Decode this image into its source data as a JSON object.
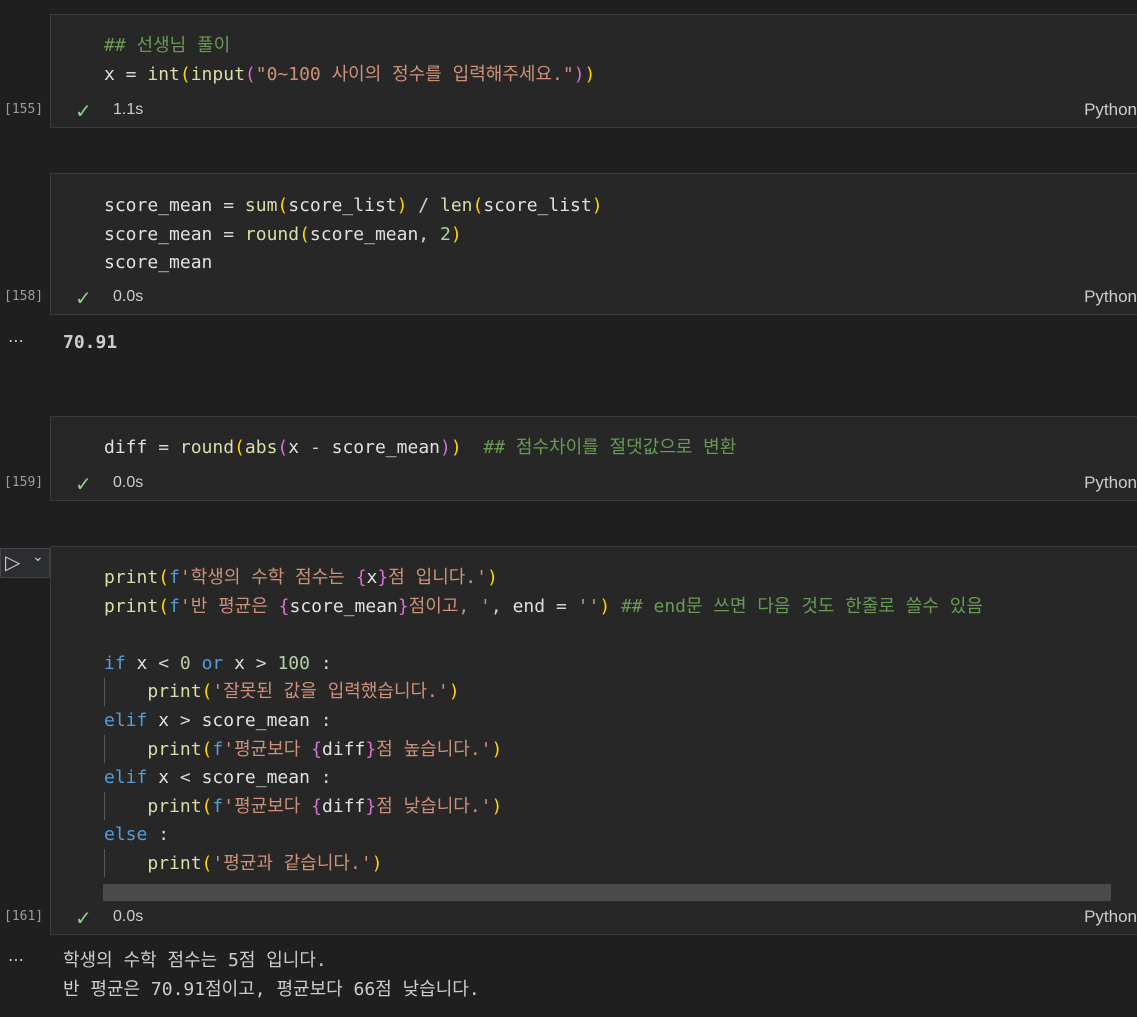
{
  "cells": [
    {
      "exec_count": "[155]",
      "duration": "1.1s",
      "language": "Python",
      "lines": [
        "## 선생님 풀이",
        "x = int(input(\"0~100 사이의 정수를 입력해주세요.\"))"
      ]
    },
    {
      "exec_count": "[158]",
      "duration": "0.0s",
      "language": "Python",
      "lines": [
        "score_mean = sum(score_list) / len(score_list)",
        "score_mean = round(score_mean, 2)",
        "score_mean"
      ],
      "output_lines": [
        "70.91"
      ]
    },
    {
      "exec_count": "[159]",
      "duration": "0.0s",
      "language": "Python",
      "lines": [
        "diff = round(abs(x - score_mean))  ## 점수차이를 절댓값으로 변환"
      ]
    },
    {
      "exec_count": "[161]",
      "duration": "0.0s",
      "language": "Python",
      "lines": [
        "print(f'학생의 수학 점수는 {x}점 입니다.')",
        "print(f'반 평균은 {score_mean}점이고, ', end = '') ## end문 쓰면 다음 것도 한줄로 쓸수 있음",
        "",
        "if x < 0 or x > 100 :",
        "    print('잘못된 값을 입력했습니다.')",
        "elif x > score_mean :",
        "    print(f'평균보다 {diff}점 높습니다.')",
        "elif x < score_mean :",
        "    print(f'평균보다 {diff}점 낮습니다.')",
        "else :",
        "    print('평균과 같습니다.')"
      ],
      "output_lines": [
        "학생의 수학 점수는 5점 입니다.",
        "반 평균은 70.91점이고, 평균보다 66점 낮습니다."
      ]
    }
  ],
  "icons": {
    "check": "✓",
    "ellipsis": "⋯",
    "run": "▷",
    "chevron": "⌄"
  },
  "colors": {
    "background": "#1f1f1f",
    "cell_background": "#272727",
    "check": "#89d185",
    "keyword": "#569cd6",
    "string": "#ce9178",
    "comment": "#6a9955",
    "function": "#dcdcaa"
  }
}
